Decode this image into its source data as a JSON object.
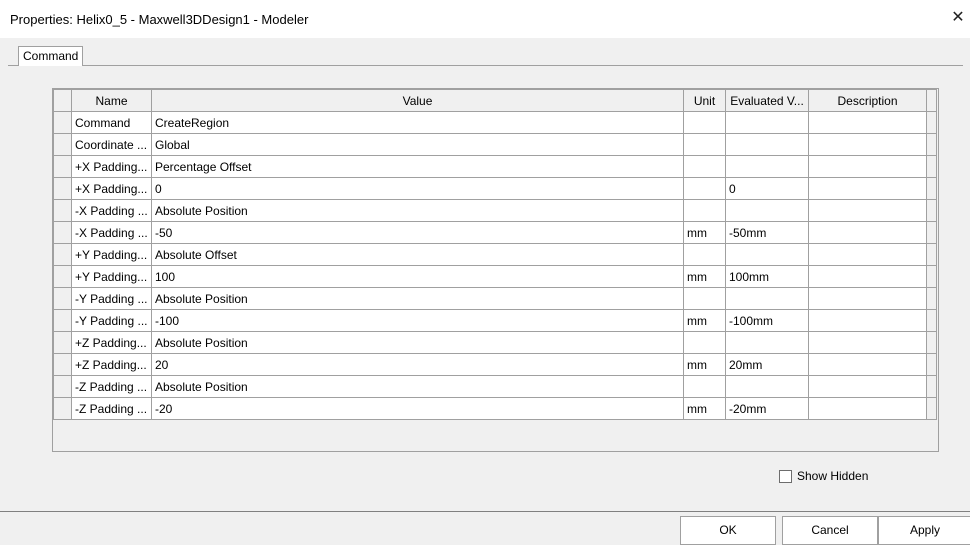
{
  "window": {
    "title": "Properties: Helix0_5 - Maxwell3DDesign1 - Modeler",
    "close_icon": "close-icon"
  },
  "tabs": [
    {
      "label": "Command",
      "active": true
    }
  ],
  "grid": {
    "headers": [
      "Name",
      "Value",
      "Unit",
      "Evaluated V...",
      "Description"
    ],
    "rows": [
      {
        "name": "Command",
        "value": "CreateRegion",
        "unit": "",
        "evaluated": "",
        "description": ""
      },
      {
        "name": "Coordinate ...",
        "value": "Global",
        "unit": "",
        "evaluated": "",
        "description": ""
      },
      {
        "name": "+X Padding...",
        "value": "Percentage Offset",
        "unit": "",
        "evaluated": "",
        "description": ""
      },
      {
        "name": "+X Padding...",
        "value": "0",
        "unit": "",
        "evaluated": "0",
        "description": ""
      },
      {
        "name": "-X Padding ...",
        "value": "Absolute Position",
        "unit": "",
        "evaluated": "",
        "description": ""
      },
      {
        "name": "-X Padding ...",
        "value": "-50",
        "unit": "mm",
        "evaluated": "-50mm",
        "description": ""
      },
      {
        "name": "+Y Padding...",
        "value": "Absolute Offset",
        "unit": "",
        "evaluated": "",
        "description": ""
      },
      {
        "name": "+Y Padding...",
        "value": "100",
        "unit": "mm",
        "evaluated": "100mm",
        "description": ""
      },
      {
        "name": "-Y Padding ...",
        "value": "Absolute Position",
        "unit": "",
        "evaluated": "",
        "description": ""
      },
      {
        "name": "-Y Padding ...",
        "value": "-100",
        "unit": "mm",
        "evaluated": "-100mm",
        "description": ""
      },
      {
        "name": "+Z Padding...",
        "value": "Absolute Position",
        "unit": "",
        "evaluated": "",
        "description": ""
      },
      {
        "name": "+Z Padding...",
        "value": "20",
        "unit": "mm",
        "evaluated": "20mm",
        "description": ""
      },
      {
        "name": "-Z Padding ...",
        "value": "Absolute Position",
        "unit": "",
        "evaluated": "",
        "description": ""
      },
      {
        "name": "-Z Padding ...",
        "value": "-20",
        "unit": "mm",
        "evaluated": "-20mm",
        "description": ""
      }
    ]
  },
  "show_hidden": {
    "label": "Show Hidden",
    "checked": false
  },
  "buttons": {
    "ok": "OK",
    "cancel": "Cancel",
    "apply": "Apply"
  }
}
